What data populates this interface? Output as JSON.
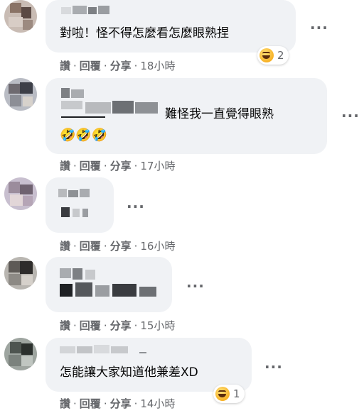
{
  "comments": [
    {
      "text": "對啦！怪不得怎麼看怎麼眼熟捏",
      "emojis": "",
      "reaction": {
        "icon": "laughing-emoji-icon",
        "count": "2"
      },
      "actions": {
        "like": "讚",
        "reply": "回覆",
        "share": "分享",
        "time": "18小時"
      }
    },
    {
      "text": "難怪我一直覺得眼熟",
      "emojis": "🤣🤣🤣",
      "reaction": null,
      "actions": {
        "like": "讚",
        "reply": "回覆",
        "share": "分享",
        "time": "17小時"
      }
    },
    {
      "text": "",
      "emojis": "",
      "reaction": null,
      "actions": {
        "like": "讚",
        "reply": "回覆",
        "share": "分享",
        "time": "16小時"
      }
    },
    {
      "text": "",
      "emojis": "",
      "reaction": null,
      "actions": {
        "like": "讚",
        "reply": "回覆",
        "share": "分享",
        "time": "15小時"
      }
    },
    {
      "text": "怎能讓大家知道他兼差XD",
      "emojis": "",
      "reaction": {
        "icon": "laughing-emoji-icon",
        "count": "1"
      },
      "actions": {
        "like": "讚",
        "reply": "回覆",
        "share": "分享",
        "time": "14小時"
      }
    }
  ],
  "colors": {
    "bubble": "#f0f2f5",
    "meta_text": "#65676b",
    "text": "#050505"
  },
  "icons": {
    "more": "more-options-icon",
    "avatar": "avatar-image"
  }
}
